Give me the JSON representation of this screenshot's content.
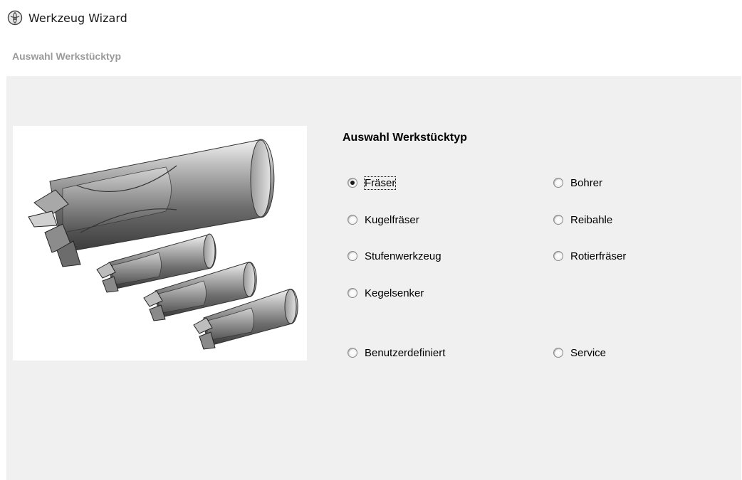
{
  "window": {
    "title": "Werkzeug Wizard",
    "icon": "wizard-globe-icon"
  },
  "page": {
    "subheading": "Auswahl Werkstücktyp"
  },
  "group": {
    "title": "Auswahl Werkstücktyp",
    "options": [
      {
        "label": "Fräser",
        "checked": true
      },
      {
        "label": "Kugelfräser",
        "checked": false
      },
      {
        "label": "Stufenwerkzeug",
        "checked": false
      },
      {
        "label": "Kegelsenker",
        "checked": false
      },
      {
        "label": "Benutzerdefiniert",
        "checked": false
      },
      {
        "label": "Bohrer",
        "checked": false
      },
      {
        "label": "Reibahle",
        "checked": false
      },
      {
        "label": "Rotierfräser",
        "checked": false
      },
      {
        "label": "Service",
        "checked": false
      }
    ]
  },
  "image": {
    "subject": "end-mill-tools-illustration"
  }
}
